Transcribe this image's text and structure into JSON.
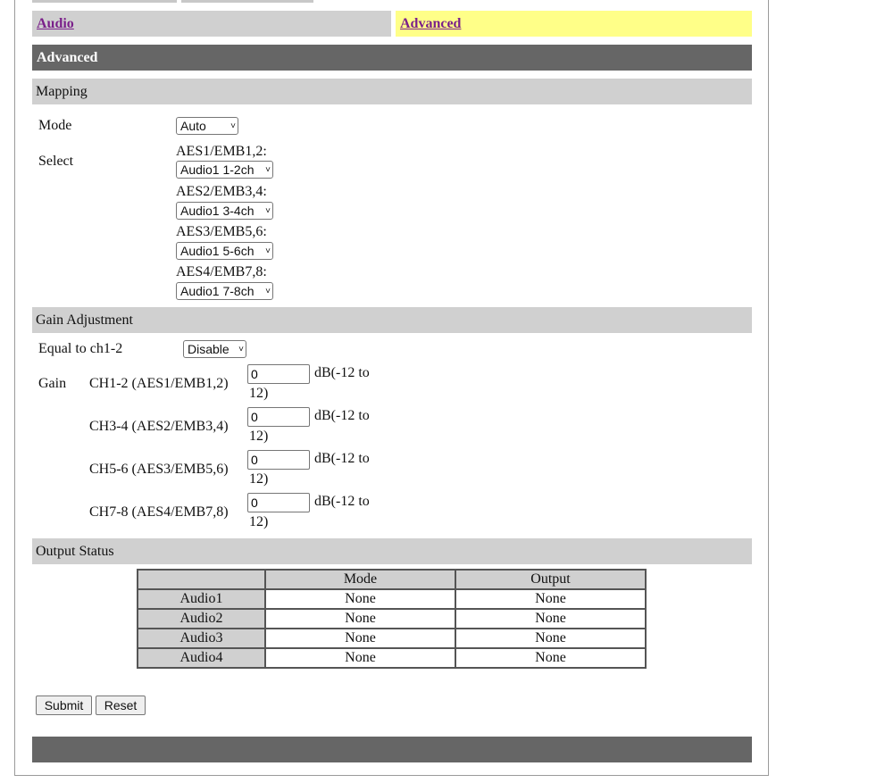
{
  "tabs": {
    "audio": "Audio",
    "advanced": "Advanced"
  },
  "section_title": "Advanced",
  "mapping": {
    "header": "Mapping",
    "mode_label": "Mode",
    "mode_value": "Auto",
    "select_label": "Select",
    "channels": [
      {
        "label": "AES1/EMB1,2:",
        "value": "Audio1 1-2ch"
      },
      {
        "label": "AES2/EMB3,4:",
        "value": "Audio1 3-4ch"
      },
      {
        "label": "AES3/EMB5,6:",
        "value": "Audio1 5-6ch"
      },
      {
        "label": "AES4/EMB7,8:",
        "value": "Audio1 7-8ch"
      }
    ]
  },
  "gain": {
    "header": "Gain Adjustment",
    "equal_label": "Equal to ch1-2",
    "equal_value": "Disable",
    "gain_label": "Gain",
    "rows": [
      {
        "label": "CH1-2 (AES1/EMB1,2)",
        "value": "0",
        "unit_a": "dB(-12 to",
        "unit_b": "12)"
      },
      {
        "label": "CH3-4 (AES2/EMB3,4)",
        "value": "0",
        "unit_a": "dB(-12 to",
        "unit_b": "12)"
      },
      {
        "label": "CH5-6 (AES3/EMB5,6)",
        "value": "0",
        "unit_a": "dB(-12 to",
        "unit_b": "12)"
      },
      {
        "label": "CH7-8 (AES4/EMB7,8)",
        "value": "0",
        "unit_a": "dB(-12 to",
        "unit_b": "12)"
      }
    ]
  },
  "output_status": {
    "header": "Output Status",
    "columns": [
      "",
      "Mode",
      "Output"
    ],
    "rows": [
      {
        "name": "Audio1",
        "mode": "None",
        "output": "None"
      },
      {
        "name": "Audio2",
        "mode": "None",
        "output": "None"
      },
      {
        "name": "Audio3",
        "mode": "None",
        "output": "None"
      },
      {
        "name": "Audio4",
        "mode": "None",
        "output": "None"
      }
    ]
  },
  "buttons": {
    "submit": "Submit",
    "reset": "Reset"
  },
  "colors": {
    "dark_bar": "#666666",
    "light_bar": "#d0d0d0",
    "active_tab": "#ffff88",
    "link": "#7a1f8a"
  }
}
